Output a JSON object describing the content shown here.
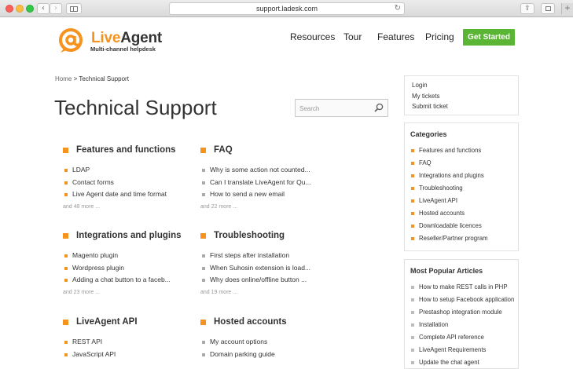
{
  "browser": {
    "url": "support.ladesk.com",
    "back": "‹",
    "forward": "›",
    "reload": "↻",
    "share": "⇪",
    "new_tab": "+"
  },
  "logo": {
    "name_live": "Live",
    "name_agent": "Agent",
    "tagline": "Multi-channel helpdesk"
  },
  "nav": {
    "resources": "Resources",
    "tour": "Tour",
    "features": "Features",
    "pricing": "Pricing",
    "cta": "Get Started"
  },
  "breadcrumb": {
    "home": "Home",
    "separator": " > ",
    "current": "Technical Support"
  },
  "page_title": "Technical Support",
  "search": {
    "placeholder": "Search"
  },
  "categories": [
    {
      "title": "Features and functions",
      "items": [
        "LDAP",
        "Contact forms",
        "Live Agent date and time format"
      ],
      "more": "and 48 more ..."
    },
    {
      "title": "FAQ",
      "items": [
        "Why is some action not counted...",
        "Can I translate LiveAgent for Qu...",
        "How to send a new email"
      ],
      "more": "and 22 more ..."
    },
    {
      "title": "Integrations and plugins",
      "items": [
        "Magento plugin",
        "Wordpress plugin",
        "Adding a chat button to a faceb..."
      ],
      "more": "and 23 more ..."
    },
    {
      "title": "Troubleshooting",
      "items": [
        "First steps after installation",
        "When Suhosin extension is load...",
        "Why does online/offline button ..."
      ],
      "more": "and 19 more ..."
    },
    {
      "title": "LiveAgent API",
      "items": [
        "REST API",
        "JavaScript API"
      ]
    },
    {
      "title": "Hosted accounts",
      "items": [
        "My account options",
        "Domain parking guide"
      ]
    }
  ],
  "sidebar": {
    "account_links": [
      "Login",
      "My tickets",
      "Submit ticket"
    ],
    "categories_heading": "Categories",
    "categories": [
      "Features and functions",
      "FAQ",
      "Integrations and plugins",
      "Troubleshooting",
      "LiveAgent API",
      "Hosted accounts",
      "Downloadable licences",
      "Reseller/Partner program"
    ],
    "popular_heading": "Most Popular Articles",
    "popular": [
      "How to make REST calls in PHP",
      "How to setup Facebook application",
      "Prestashop integration module",
      "Installation",
      "Complete API reference",
      "LiveAgent Requirements",
      "Update the chat agent"
    ]
  },
  "colors": {
    "accent_orange": "#f6921e",
    "cta_green": "#5bb535"
  }
}
